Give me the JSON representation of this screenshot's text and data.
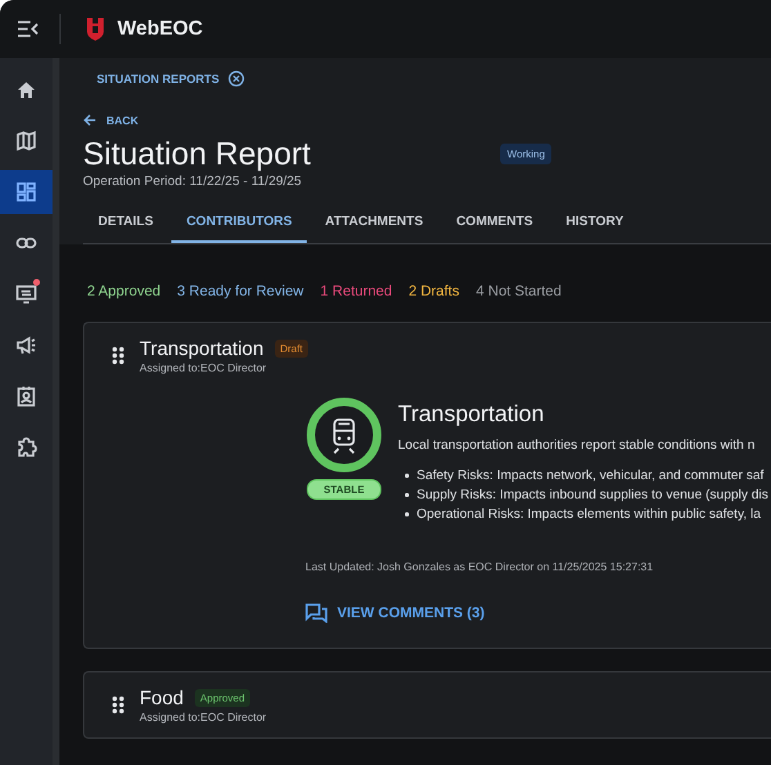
{
  "app": {
    "title": "WebEOC"
  },
  "sidebar": {
    "items": [
      {
        "kind": "home",
        "selected": false,
        "alert": false
      },
      {
        "kind": "map",
        "selected": false,
        "alert": false
      },
      {
        "kind": "dashboard",
        "selected": true,
        "alert": false
      },
      {
        "kind": "link",
        "selected": false,
        "alert": false
      },
      {
        "kind": "monitor",
        "selected": false,
        "alert": true
      },
      {
        "kind": "megaphone",
        "selected": false,
        "alert": false
      },
      {
        "kind": "contact",
        "selected": false,
        "alert": false
      },
      {
        "kind": "puzzle",
        "selected": false,
        "alert": false
      }
    ]
  },
  "breadcrumb": {
    "label": "SITUATION REPORTS"
  },
  "back": {
    "label": "BACK"
  },
  "report": {
    "title": "Situation Report",
    "status": "Working",
    "period": "Operation Period: 11/22/25 - 11/29/25"
  },
  "tabs": [
    {
      "label": "DETAILS",
      "selected": false
    },
    {
      "label": "CONTRIBUTORS",
      "selected": true
    },
    {
      "label": "ATTACHMENTS",
      "selected": false
    },
    {
      "label": "COMMENTS",
      "selected": false
    },
    {
      "label": "HISTORY",
      "selected": false
    }
  ],
  "summary": [
    {
      "label": "2 Approved",
      "color": "#8fd48f"
    },
    {
      "label": "3 Ready for Review",
      "color": "#82b4e6"
    },
    {
      "label": "1 Returned",
      "color": "#ea4a7c"
    },
    {
      "label": "2 Drafts",
      "color": "#f2b640"
    },
    {
      "label": "4 Not Started",
      "color": "#9b9ea3"
    }
  ],
  "cards": [
    {
      "title": "Transportation",
      "status": {
        "label": "Draft",
        "kind": "draft"
      },
      "assigned": "Assigned to:EOC Director",
      "detail": {
        "condition": "STABLE",
        "title": "Transportation",
        "description": "Local transportation authorities report stable conditions with n",
        "bullets": [
          "Safety Risks: Impacts network, vehicular, and commuter saf",
          "Supply Risks: Impacts inbound supplies to venue (supply dis",
          "Operational Risks: Impacts elements within public safety, la"
        ],
        "updated": "Last Updated: Josh Gonzales as EOC Director on 11/25/2025 15:27:31",
        "comments": "VIEW COMMENTS (3)"
      }
    },
    {
      "title": "Food",
      "status": {
        "label": "Approved",
        "kind": "approved"
      },
      "assigned": "Assigned to:EOC Director"
    }
  ]
}
